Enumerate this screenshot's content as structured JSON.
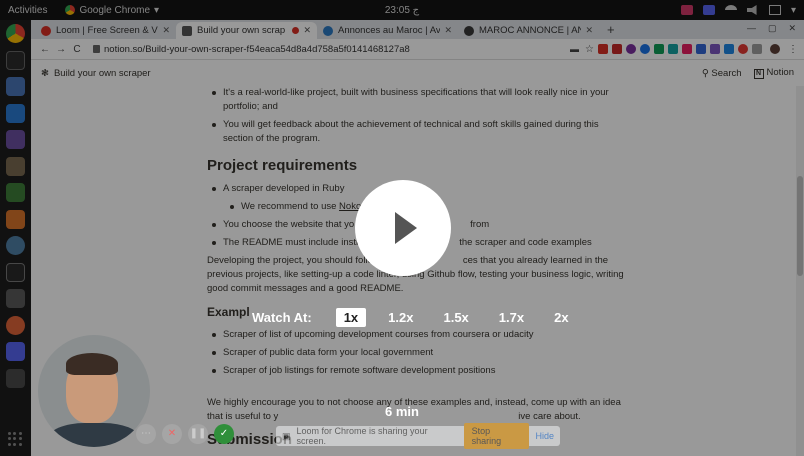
{
  "topbar": {
    "activities": "Activities",
    "app_name": "Google Chrome",
    "clock": "23:05 ‎ج"
  },
  "tabs": [
    {
      "title": "Loom | Free Screen & Vide",
      "color": "#d93025",
      "active": false
    },
    {
      "title": "Build your own scrap",
      "color": "#555555",
      "active": true,
      "recording": true
    },
    {
      "title": "Annonces au Maroc | Avit",
      "color": "#2a78c2",
      "active": false
    },
    {
      "title": "MAROC ANNONCE | ANN",
      "color": "#3a3a3a",
      "active": false
    }
  ],
  "omnibar": {
    "back": "←",
    "forward": "→",
    "reload": "C",
    "url": "notion.so/Build-your-own-scraper-f54eaca54d8a4d758a5f0141468127a8"
  },
  "notion": {
    "breadcrumb": "Build your own scraper",
    "search": "Search",
    "brand": "Notion"
  },
  "content": {
    "intro_bullets": [
      "It's a real-world-like project, built with business specifications that will look really nice in your portfolio; and",
      "You will get feedback about the achievement of technical and soft skills gained during this section of the program."
    ],
    "requirements_heading": "Project requirements",
    "req1": "A scraper developed in Ruby",
    "req1_sub_prefix": "We recommend to use ",
    "req1_sub_link": "Nokog",
    "req2_left": "You choose the website that yo",
    "req2_right": "from",
    "req3_left": "The README must include instr",
    "req3_right": "the scraper and code examples",
    "paragraph_line1_left": "Developing the project, you should follo",
    "paragraph_line1_right": "ces that you already learned in the",
    "paragraph_rest": "previous projects, like setting-up a code linter, using Github flow, testing your business logic, writing good commit messages and a good README.",
    "examples_heading": "Exampl",
    "examples": [
      "Scraper of list of upcoming development courses from coursera or udacity",
      "Scraper of public data form your local government",
      "Scraper of job listings for remote software development positions"
    ],
    "closing_line1": "We highly encourage you to not choose any of these examples and, instead, come up with an idea",
    "closing_line2_left": "that is useful to y",
    "closing_line2_right": "ive care about.",
    "submission_heading": "Submission"
  },
  "loom": {
    "watch_label": "Watch At:",
    "speeds": [
      "1x",
      "1.2x",
      "1.5x",
      "1.7x",
      "2x"
    ],
    "selected_speed": "1x",
    "duration": "6 min",
    "share_text": "Loom for Chrome is sharing your screen.",
    "stop_label": "Stop sharing",
    "hide_label": "Hide"
  }
}
